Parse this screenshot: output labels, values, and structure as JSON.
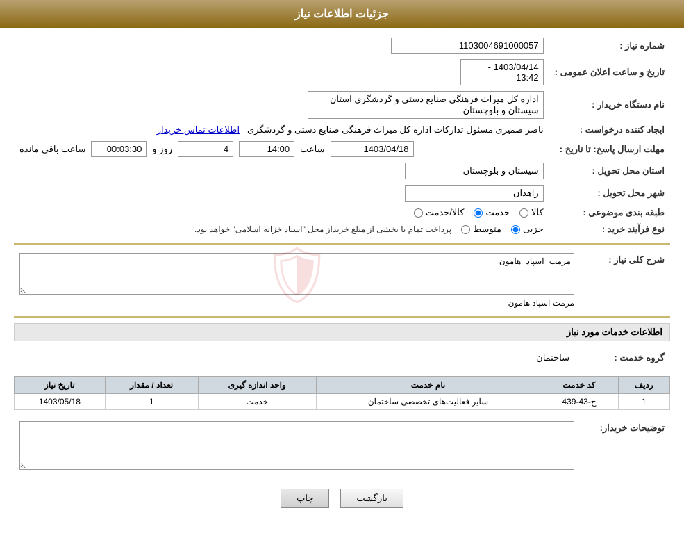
{
  "header": {
    "title": "جزئیات اطلاعات نیاز"
  },
  "fields": {
    "shomareNiaz_label": "شماره نیاز :",
    "shomareNiaz_value": "1103004691000057",
    "namdastgah_label": "نام دستگاه خریدار :",
    "namdastgah_value": "اداره کل میراث فرهنگی  صنایع دستی و گردشگری استان سیستان و بلوچستان",
    "tarikh_label": "تاریخ و ساعت اعلان عمومی :",
    "tarikh_value": "1403/04/14 - 13:42",
    "ijadkonande_label": "ایجاد کننده درخواست :",
    "ijadkonande_value": "ناصر ضمیری مسئول تدارکات اداره کل میراث فرهنگی  صنایع دستی و گردشگری",
    "ijadkonande_link": "اطلاعات تماس خریدار",
    "mohlatErsalLabel": "مهلت ارسال پاسخ: تا تاریخ :",
    "mohlatTarikh": "1403/04/18",
    "mohlatSaat": "14:00",
    "mohlatRoz": "4",
    "mohlatSaatMande": "00:03:30",
    "mohlatRozLabel": "روز و",
    "mohlatSaatMandeLabel": "ساعت باقی مانده",
    "mohlatSaatLabel": "ساعت",
    "ostan_label": "استان محل تحویل :",
    "ostan_value": "سیستان و بلوچستان",
    "shahr_label": "شهر محل تحویل :",
    "shahr_value": "زاهدان",
    "tabaqeBandi_label": "طبقه بندی موضوعی :",
    "tabaqe_kala": "کالا",
    "tabaqe_khadamat": "خدمت",
    "tabaqe_kalaKhadamat": "کالا/خدمت",
    "noefarayand_label": "نوع فرآیند خرید :",
    "noefarayand_jozi": "جزیی",
    "noefarayand_motevaset": "متوسط",
    "noefarayand_note": "پرداخت تمام یا بخشی از مبلغ خریداز محل \"اسناد خزانه اسلامی\" خواهد بود.",
    "sharhKoli_label": "شرح کلی نیاز :",
    "sharhKoli_value": "مرمت اسپاد هامون",
    "khadamatLabel": "اطلاعات خدمات مورد نیاز",
    "grohKhadamat_label": "گروه خدمت :",
    "grohKhadamat_value": "ساختمان",
    "services_table": {
      "headers": [
        "ردیف",
        "کد خدمت",
        "نام خدمت",
        "واحد اندازه گیری",
        "تعداد / مقدار",
        "تاریخ نیاز"
      ],
      "rows": [
        {
          "radif": "1",
          "kodKhadamat": "ج-43-439",
          "namKhadamat": "سایر فعالیت‌های تخصصی ساختمان",
          "vahed": "خدمت",
          "tedad": "1",
          "tarikh": "1403/05/18"
        }
      ]
    },
    "tosihKharidar_label": "توضیحات خریدار:",
    "tosihKharidar_value": ""
  },
  "buttons": {
    "print_label": "چاپ",
    "back_label": "بازگشت"
  }
}
